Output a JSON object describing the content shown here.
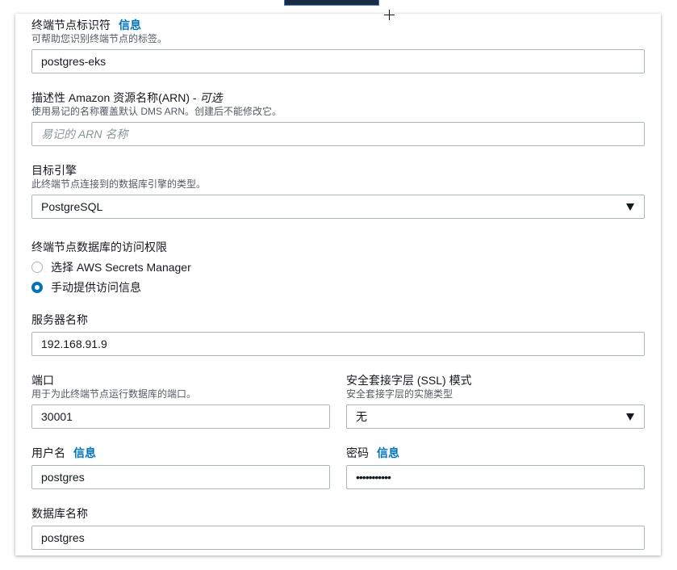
{
  "form": {
    "endpoint_id": {
      "label": "终端节点标识符",
      "info": "信息",
      "description": "可帮助您识别终端节点的标签。",
      "value": "postgres-eks"
    },
    "arn": {
      "label": "描述性 Amazon 资源名称(ARN) - ",
      "optional": "可选",
      "description": "使用易记的名称覆盖默认 DMS ARN。创建后不能修改它。",
      "placeholder": "易记的 ARN 名称"
    },
    "target_engine": {
      "label": "目标引擎",
      "description": "此终端节点连接到的数据库引擎的类型。",
      "value": "PostgreSQL"
    },
    "access": {
      "label": "终端节点数据库的访问权限",
      "options": [
        {
          "label": "选择 AWS Secrets Manager",
          "checked": false
        },
        {
          "label": "手动提供访问信息",
          "checked": true
        }
      ]
    },
    "server_name": {
      "label": "服务器名称",
      "value": "192.168.91.9"
    },
    "port": {
      "label": "端口",
      "description": "用于为此终端节点运行数据库的端口。",
      "value": "30001"
    },
    "ssl_mode": {
      "label": "安全套接字层 (SSL) 模式",
      "description": "安全套接字层的实施类型",
      "value": "无"
    },
    "username": {
      "label": "用户名",
      "info": "信息",
      "value": "postgres"
    },
    "password": {
      "label": "密码",
      "info": "信息",
      "value": "•••••••••••"
    },
    "database_name": {
      "label": "数据库名称",
      "value": "postgres"
    }
  },
  "colors": {
    "info_link": "#0073bb",
    "border": "#aab7b8",
    "text": "#16191f",
    "description": "#545b64"
  }
}
